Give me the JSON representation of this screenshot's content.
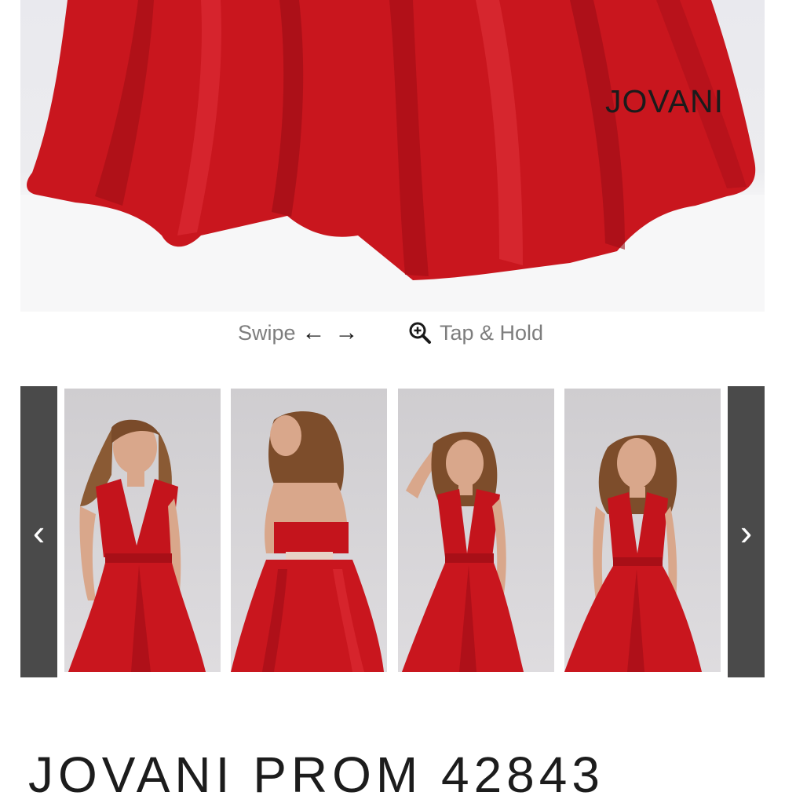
{
  "main_image": {
    "brand_logo": "JOVANI",
    "dress_color": "#c8161d"
  },
  "hints": {
    "swipe_label": "Swipe",
    "arrow_left": "←",
    "arrow_right": "→",
    "zoom_label": "Tap & Hold",
    "zoom_icon": "zoom-in-icon"
  },
  "carousel": {
    "prev_label": "‹",
    "next_label": "›",
    "thumbnails": [
      {
        "view": "front"
      },
      {
        "view": "back"
      },
      {
        "view": "front-pose"
      },
      {
        "view": "front-overskirt"
      }
    ]
  },
  "product": {
    "title": "JOVANI PROM 42843"
  }
}
